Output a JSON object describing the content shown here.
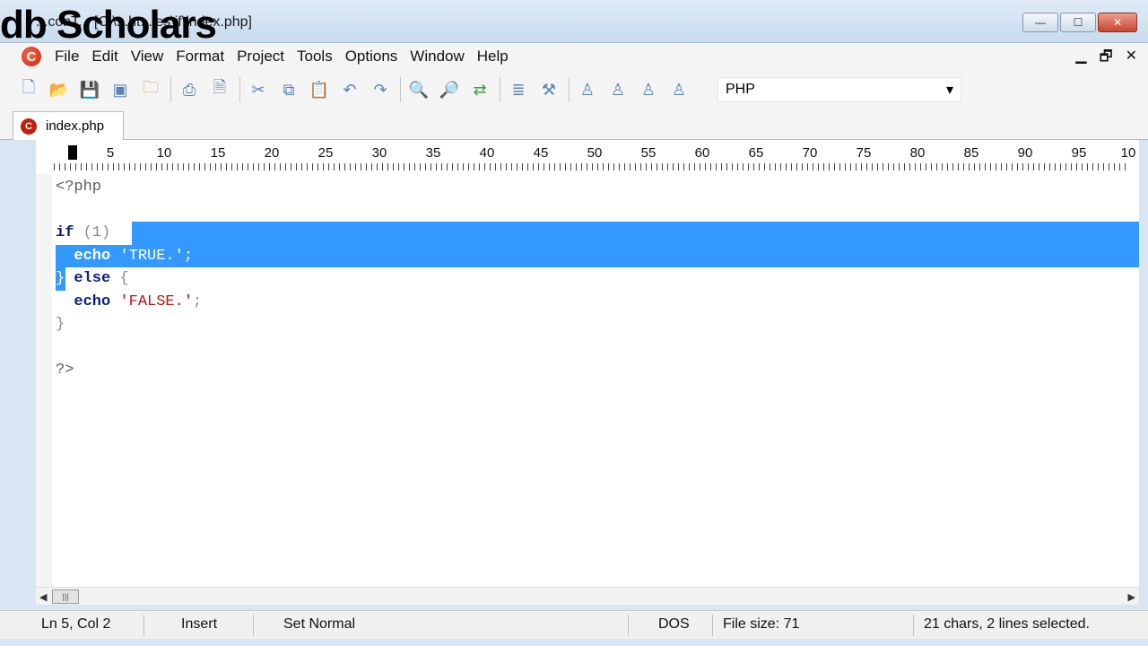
{
  "window": {
    "title": "...conT... [C:\\...ht...ies\\if\\index.php]",
    "watermark": "db Scholars",
    "minimize": "—",
    "maximize": "☐",
    "close": "✕"
  },
  "menu": {
    "items": [
      "File",
      "Edit",
      "View",
      "Format",
      "Project",
      "Tools",
      "Options",
      "Window",
      "Help"
    ],
    "mdi_min": "▁",
    "mdi_restore": "🗗",
    "mdi_close": "✕"
  },
  "toolbar": {
    "language": "PHP",
    "dropdown_arrow": "▾"
  },
  "tab": {
    "label": "index.php"
  },
  "ruler": {
    "marks": [
      "5",
      "10",
      "15",
      "20",
      "25",
      "30",
      "35",
      "40",
      "45",
      "50",
      "55",
      "60",
      "65",
      "70",
      "75",
      "80",
      "85",
      "90",
      "95",
      "10"
    ]
  },
  "code": {
    "lines": [
      "<?php",
      "",
      "if (1) {",
      "  echo 'TRUE.';",
      "} else {",
      "  echo 'FALSE.';",
      "}",
      "",
      "?>"
    ]
  },
  "status": {
    "position": "Ln 5, Col 2",
    "mode": "Insert",
    "selection_mode": "Set Normal",
    "line_ending": "DOS",
    "file_size": "File size: 71",
    "selection_info": "21 chars, 2 lines selected."
  },
  "colors": {
    "selection": "#3399ff",
    "keyword": "#0b1f7a",
    "string": "#c01010"
  }
}
